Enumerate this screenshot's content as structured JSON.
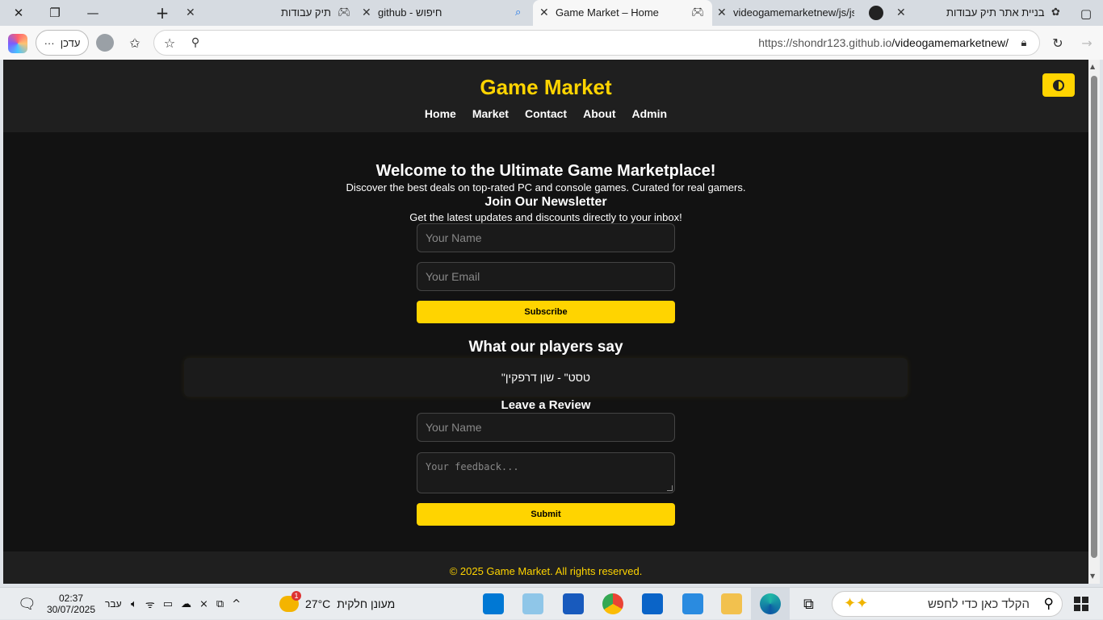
{
  "browser": {
    "window_controls": {
      "close": "✕",
      "restore": "❐",
      "minimize": "—",
      "new_tab": "+"
    },
    "tabs": [
      {
        "title": "תיק עבודות",
        "active": false
      },
      {
        "title": "github - חיפוש",
        "active": false
      },
      {
        "title": "Game Market – Home",
        "active": true
      },
      {
        "title": "videogamemarketnew/js/json",
        "active": false
      },
      {
        "title": "בניית אתר תיק עבודות",
        "active": false
      }
    ],
    "url_host": "https://shondr123.github.io",
    "url_path": "/videogamemarketnew/",
    "update_label": "עדכן",
    "update_more": "···"
  },
  "site": {
    "title": "Game Market",
    "nav": [
      "Home",
      "Market",
      "Contact",
      "About",
      "Admin"
    ],
    "welcome_heading": "Welcome to the Ultimate Game Marketplace!",
    "welcome_text": "Discover the best deals on top-rated PC and console games. Curated for real gamers.",
    "newsletter_heading": "Join Our Newsletter",
    "newsletter_text": "Get the latest updates and discounts directly to your inbox!",
    "newsletter_name_placeholder": "Your Name",
    "newsletter_email_placeholder": "Your Email",
    "subscribe_label": "Subscribe",
    "reviews_heading": "What our players say",
    "reviews": [
      "\"טסט\" - שון דרפקין"
    ],
    "leave_review_heading": "Leave a Review",
    "review_name_placeholder": "Your Name",
    "review_feedback_placeholder": "Your feedback...",
    "submit_label": "Submit",
    "footer": "© 2025 Game Market. All rights reserved."
  },
  "taskbar": {
    "time": "02:37",
    "date": "30/07/2025",
    "language": "עבר",
    "temperature": "27°C",
    "weather": "מעונן חלקית",
    "weather_badge": "1",
    "search_placeholder": "הקלד כאן כדי לחפש",
    "apps": [
      "vscode",
      "notepad",
      "word",
      "chrome",
      "outlook",
      "store",
      "file-explorer",
      "edge",
      "task-view"
    ]
  }
}
